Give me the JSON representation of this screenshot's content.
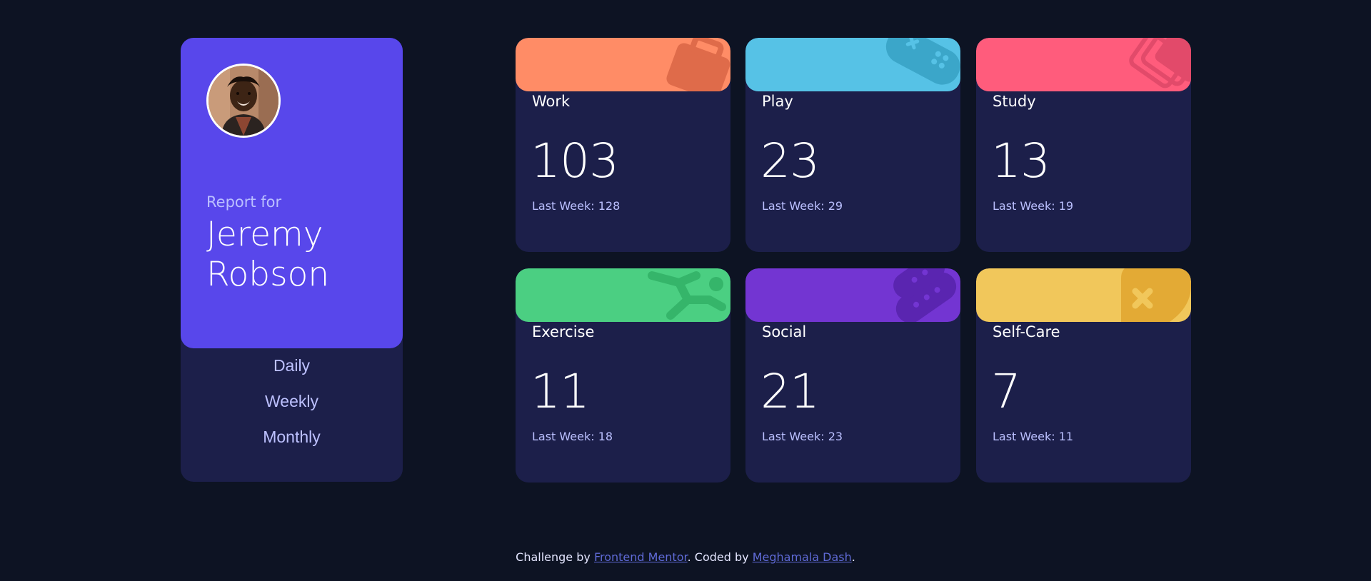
{
  "profile": {
    "report_for": "Report for",
    "name": "Jeremy Robson",
    "periods": [
      "Daily",
      "Weekly",
      "Monthly"
    ]
  },
  "cards": [
    {
      "title": "Work",
      "current": "103",
      "previous": "Last Week: 128",
      "color": "#ff8c66",
      "icon": "briefcase-icon"
    },
    {
      "title": "Play",
      "current": "23",
      "previous": "Last Week: 29",
      "color": "#56c2e6",
      "icon": "game-controller-icon"
    },
    {
      "title": "Study",
      "current": "13",
      "previous": "Last Week: 19",
      "color": "#ff5c7c",
      "icon": "book-icon"
    },
    {
      "title": "Exercise",
      "current": "11",
      "previous": "Last Week: 18",
      "color": "#4bcf82",
      "icon": "running-person-icon"
    },
    {
      "title": "Social",
      "current": "21",
      "previous": "Last Week: 23",
      "color": "#7335d2",
      "icon": "social-icon"
    },
    {
      "title": "Self-Care",
      "current": "7",
      "previous": "Last Week: 11",
      "color": "#f1c75b",
      "icon": "heart-bandage-icon"
    }
  ],
  "footer": {
    "prefix": "Challenge by ",
    "link1": "Frontend Mentor",
    "middle": ". Coded by ",
    "link2": "Meghamala Dash",
    "suffix": "."
  },
  "colors": {
    "background": "#0d1323",
    "card": "#1c1f4a",
    "profile_accent": "#5847eb"
  }
}
